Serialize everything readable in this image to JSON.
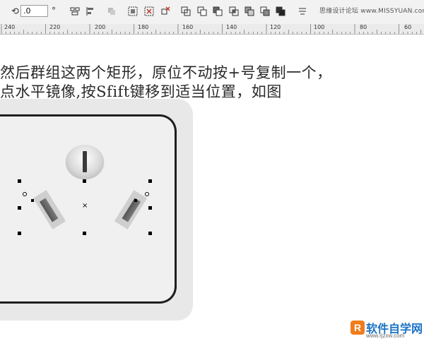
{
  "toolbar": {
    "angle_value": ".0",
    "degree_unit": "°",
    "watermark": "思缘设计论坛 www.MISSYUAN.com",
    "icons": [
      "rotate-icon",
      "align-left-icon",
      "align-distribute-icon",
      "group-icon",
      "ungroup-icon",
      "ungroup-all-icon",
      "remove-icon",
      "combine-icon",
      "weld-icon",
      "trim-icon",
      "intersect-icon",
      "simplify-icon",
      "front-minus-back-icon",
      "back-minus-front-icon",
      "boundary-icon",
      "wrap-text-icon"
    ]
  },
  "ruler": {
    "labels": [
      "240",
      "220",
      "200",
      "180",
      "160",
      "140",
      "120",
      "100",
      "80",
      "60"
    ]
  },
  "tutorial": {
    "line1": "然后群组这两个矩形，原位不动按+号复制一个，",
    "line2": "点水平镜像,按Sfift键移到适当位置，如图"
  },
  "logo": {
    "mark": "R",
    "title": "软件自学网",
    "url": "www.rjzxw.com"
  },
  "colors": {
    "logo_orange": "#f07c1b",
    "logo_blue": "#1c73c5"
  }
}
